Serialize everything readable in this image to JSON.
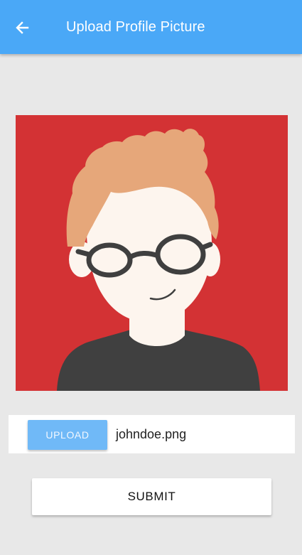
{
  "appbar": {
    "title": "Upload Profile Picture",
    "back_icon": "arrow-left-icon",
    "color": "#4aa8f7"
  },
  "avatar": {
    "background_color": "#d33234",
    "hair_color": "#e6a77a",
    "skin_color": "#fdf5ee",
    "shirt_color": "#404040"
  },
  "upload": {
    "button_label": "UPLOAD",
    "file_name": "johndoe.png"
  },
  "submit": {
    "button_label": "SUBMIT"
  }
}
